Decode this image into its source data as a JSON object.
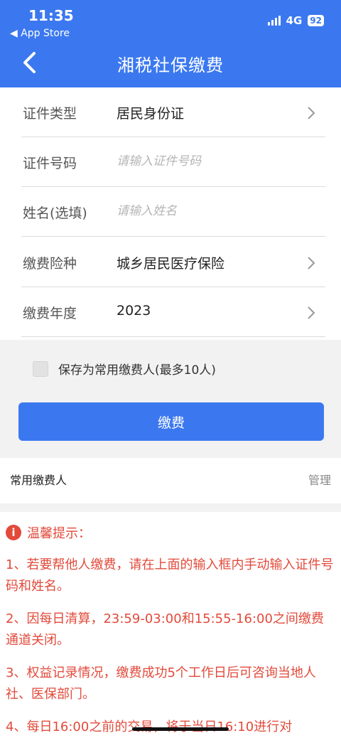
{
  "status_bar": {
    "time": "11:35",
    "back_app": "◀ App Store",
    "network": "4G",
    "battery": "92"
  },
  "nav": {
    "title": "湘税社保缴费"
  },
  "form": {
    "id_type": {
      "label": "证件类型",
      "value": "居民身份证"
    },
    "id_number": {
      "label": "证件号码",
      "placeholder": "请输入证件号码"
    },
    "name": {
      "label": "姓名(选填)",
      "placeholder": "请输入姓名"
    },
    "insurance_type": {
      "label": "缴费险种",
      "value": "城乡居民医疗保险"
    },
    "year": {
      "label": "缴费年度",
      "value": "2023"
    }
  },
  "save_payer": {
    "label": "保存为常用缴费人(最多10人)"
  },
  "pay_button": {
    "label": "缴费"
  },
  "frequent_payers": {
    "title": "常用缴费人",
    "manage": "管理"
  },
  "tips": {
    "title": "温馨提示：",
    "items": [
      "1、若要帮他人缴费，请在上面的输入框内手动输入证件号码和姓名。",
      "2、因每日清算，23:59-03:00和15:55-16:00之间缴费通道关闭。",
      "3、权益记录情况，缴费成功5个工作日后可咨询当地人社、医保部门。",
      "4、每日16:00之前的交易，将于当日16:10进行对"
    ]
  },
  "colors": {
    "primary": "#3b78f0",
    "warning": "#e24a3b"
  }
}
